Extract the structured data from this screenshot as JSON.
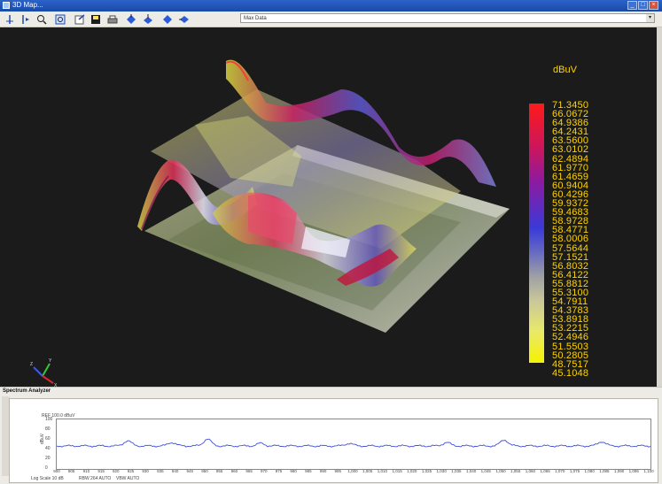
{
  "window": {
    "title": "3D Map..."
  },
  "toolbar": {
    "tools": [
      "marker-add-icon",
      "marker-move-icon",
      "zoom-icon",
      "zoom-fit-icon",
      "export-icon",
      "save-icon",
      "print-icon",
      "view-top-icon",
      "view-front-icon",
      "view-iso-icon",
      "view-side-icon"
    ],
    "data_select": "Max Data"
  },
  "color_scale": {
    "unit": "dBuV",
    "labels": [
      "71.3450",
      "66.0672",
      "64.9386",
      "64.2431",
      "63.5600",
      "63.0102",
      "62.4894",
      "61.9770",
      "61.4659",
      "60.9404",
      "60.4296",
      "59.9372",
      "59.4683",
      "58.9728",
      "58.4771",
      "58.0006",
      "57.5644",
      "57.1521",
      "56.8032",
      "56.4122",
      "55.8812",
      "55.3100",
      "54.7911",
      "54.3783",
      "53.8918",
      "53.2215",
      "52.4946",
      "51.5503",
      "50.2805",
      "48.7517",
      "45.1048"
    ],
    "top_color": "#ff1a1a",
    "bottom_color": "#f4f300"
  },
  "spectrum": {
    "title": "Spectrum Analyzer",
    "ref_label": "REF 100.0 dBuV",
    "ylabel": "dBuV",
    "yticks": [
      "100",
      "80",
      "60",
      "40",
      "20",
      "0"
    ],
    "xticks": [
      "900",
      "905",
      "910",
      "915",
      "920",
      "925",
      "930",
      "935",
      "940",
      "945",
      "950",
      "955",
      "960",
      "965",
      "970",
      "975",
      "980",
      "985",
      "990",
      "995",
      "1,000",
      "1,005",
      "1,010",
      "1,015",
      "1,020",
      "1,025",
      "1,030",
      "1,035",
      "1,040",
      "1,045",
      "1,050",
      "1,055",
      "1,060",
      "1,065",
      "1,070",
      "1,075",
      "1,080",
      "1,085",
      "1,090",
      "1,095",
      "1,100"
    ],
    "footer": [
      "Log Scale 10 dB",
      "RBW 264 AUTO",
      "VBW AUTO"
    ],
    "trace_color": "#3d4fd6"
  }
}
